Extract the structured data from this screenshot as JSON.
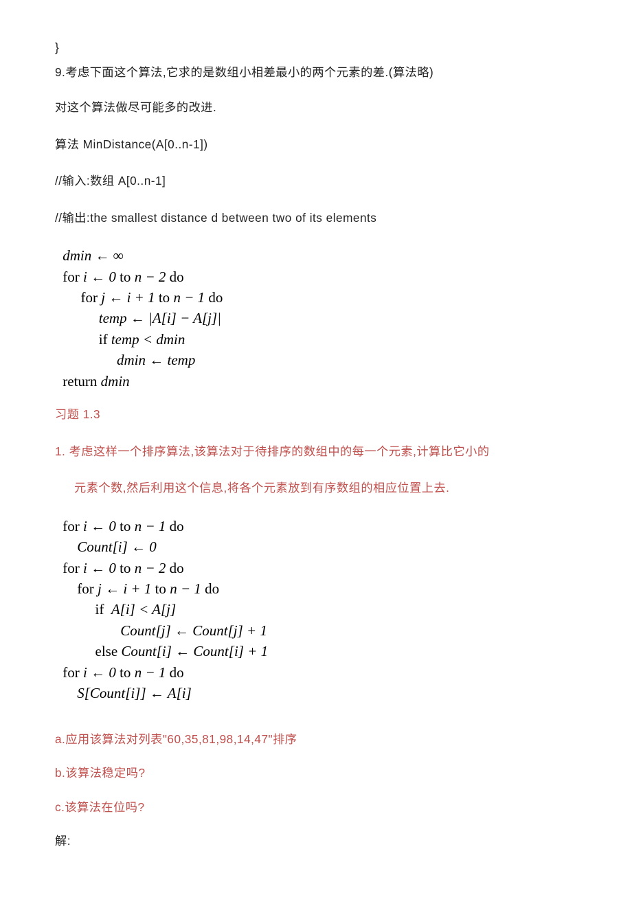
{
  "closingBrace": "}",
  "problem9": {
    "prompt": "9.考虑下面这个算法,它求的是数组小相差最小的两个元素的差.(算法略)",
    "improveNote": "对这个算法做尽可能多的改进.",
    "algLabel": "算法  MinDistance(A[0..n-1])",
    "inputLine": "//输入:数组 A[0..n-1]",
    "outputLine": "//输出:the smallest distance d between two of its elements",
    "code": {
      "l1": "dmin ← ∞",
      "l2_for": "for ",
      "l2_rest": "i ← 0 ",
      "l2_to": "to ",
      "l2_n2": "n − 2 ",
      "l2_do": "do",
      "l3_for": "for ",
      "l3_rest": "j ← i + 1 ",
      "l3_to": "to ",
      "l3_n1": "n − 1 ",
      "l3_do": "do",
      "l4": "temp ← |A[i] − A[j]|",
      "l5_if": "if ",
      "l5_rest": "temp < dmin",
      "l6": "dmin ← temp",
      "l7_ret": "return ",
      "l7_v": "dmin"
    }
  },
  "section13": {
    "heading": "习题 1.3",
    "q1_line1": "1.   考虑这样一个排序算法,该算法对于待排序的数组中的每一个元素,计算比它小的",
    "q1_line2": "元素个数,然后利用这个信息,将各个元素放到有序数组的相应位置上去.",
    "code": {
      "l1_for": "for ",
      "l1_rest": "i ← 0 ",
      "l1_to": "to ",
      "l1_n1": "n − 1 ",
      "l1_do": "do",
      "l2": "Count[i] ← 0",
      "l3_for": "for ",
      "l3_rest": "i ← 0 ",
      "l3_to": "to ",
      "l3_n2": "n − 2 ",
      "l3_do": "do",
      "l4_for": "for ",
      "l4_rest": "j ← i + 1 ",
      "l4_to": "to ",
      "l4_n1": "n − 1 ",
      "l4_do": "do",
      "l5_if": "if  ",
      "l5_rest": "A[i] < A[j]",
      "l6": "Count[j] ← Count[j] + 1",
      "l7_else": "else ",
      "l7_rest": "Count[i] ← Count[i] + 1",
      "l8_for": "for ",
      "l8_rest": "i ← 0 ",
      "l8_to": "to ",
      "l8_n1": "n − 1 ",
      "l8_do": "do",
      "l9": "S[Count[i]] ← A[i]"
    },
    "qa": "a.应用该算法对列表\"60,35,81,98,14,47\"排序",
    "qb": "b.该算法稳定吗?",
    "qc": "c.该算法在位吗?",
    "answerLabel": "解:"
  }
}
